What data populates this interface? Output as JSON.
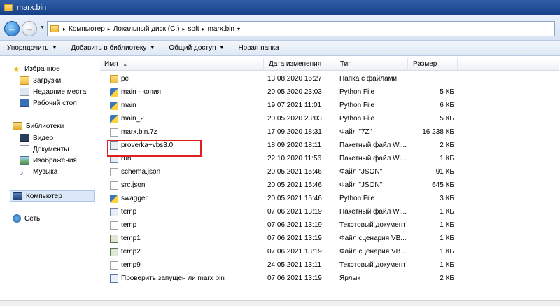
{
  "window": {
    "title": "marx.bin"
  },
  "address": {
    "crumbs": [
      "Компьютер",
      "Локальный диск (C:)",
      "soft",
      "marx.bin"
    ]
  },
  "toolbar": {
    "organize": "Упорядочить",
    "add_library": "Добавить в библиотеку",
    "share": "Общий доступ",
    "new_folder": "Новая папка"
  },
  "nav": {
    "favorites": "Избранное",
    "downloads": "Загрузки",
    "recent": "Недавние места",
    "desktop": "Рабочий стол",
    "libraries": "Библиотеки",
    "video": "Видео",
    "documents": "Документы",
    "images": "Изображения",
    "music": "Музыка",
    "computer": "Компьютер",
    "network": "Сеть"
  },
  "columns": {
    "name": "Имя",
    "date": "Дата изменения",
    "type": "Тип",
    "size": "Размер"
  },
  "files": [
    {
      "name": "pe",
      "date": "13.08.2020 16:27",
      "type": "Папка с файлами",
      "size": "",
      "icon": "folder"
    },
    {
      "name": "main - копия",
      "date": "20.05.2020 23:03",
      "type": "Python File",
      "size": "5 КБ",
      "icon": "py"
    },
    {
      "name": "main",
      "date": "19.07.2021 11:01",
      "type": "Python File",
      "size": "6 КБ",
      "icon": "py"
    },
    {
      "name": "main_2",
      "date": "20.05.2020 23:03",
      "type": "Python File",
      "size": "5 КБ",
      "icon": "py"
    },
    {
      "name": "marx.bin.7z",
      "date": "17.09.2020 18:31",
      "type": "Файл \"7Z\"",
      "size": "16 238 КБ",
      "icon": "file"
    },
    {
      "name": "proverka+vbs3.0",
      "date": "18.09.2020 18:11",
      "type": "Пакетный файл Wi...",
      "size": "2 КБ",
      "icon": "bat"
    },
    {
      "name": "run",
      "date": "22.10.2020 11:56",
      "type": "Пакетный файл Wi...",
      "size": "1 КБ",
      "icon": "bat"
    },
    {
      "name": "schema.json",
      "date": "20.05.2021 15:46",
      "type": "Файл \"JSON\"",
      "size": "91 КБ",
      "icon": "file"
    },
    {
      "name": "src.json",
      "date": "20.05.2021 15:46",
      "type": "Файл \"JSON\"",
      "size": "645 КБ",
      "icon": "file"
    },
    {
      "name": "swagger",
      "date": "20.05.2021 15:46",
      "type": "Python File",
      "size": "3 КБ",
      "icon": "py"
    },
    {
      "name": "temp",
      "date": "07.06.2021 13:19",
      "type": "Пакетный файл Wi...",
      "size": "1 КБ",
      "icon": "bat"
    },
    {
      "name": "temp",
      "date": "07.06.2021 13:19",
      "type": "Текстовый документ",
      "size": "1 КБ",
      "icon": "file"
    },
    {
      "name": "temp1",
      "date": "07.06.2021 13:19",
      "type": "Файл сценария VB...",
      "size": "1 КБ",
      "icon": "vbs"
    },
    {
      "name": "temp2",
      "date": "07.06.2021 13:19",
      "type": "Файл сценария VB...",
      "size": "1 КБ",
      "icon": "vbs"
    },
    {
      "name": "temp9",
      "date": "24.05.2021 13:11",
      "type": "Текстовый документ",
      "size": "1 КБ",
      "icon": "file"
    },
    {
      "name": "Проверить запущен ли marx bin",
      "date": "07.06.2021 13:19",
      "type": "Ярлык",
      "size": "2 КБ",
      "icon": "lnk"
    }
  ]
}
